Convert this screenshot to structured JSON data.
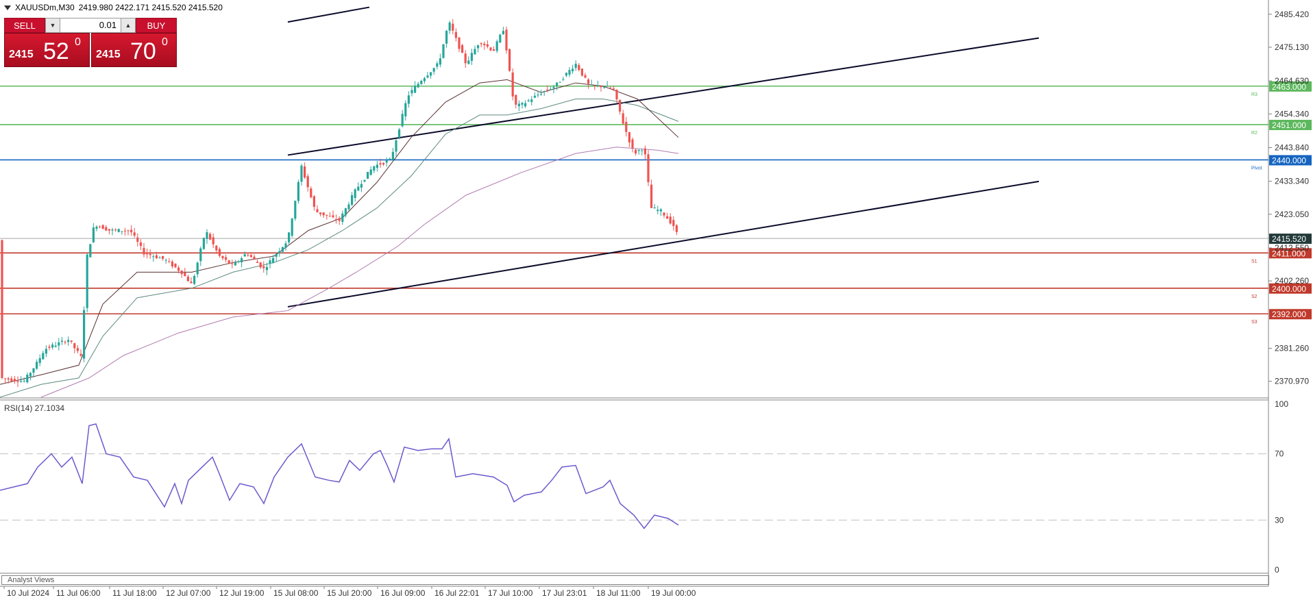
{
  "header": {
    "symbol": "XAUUSDm,M30",
    "ohlc": "2419.980 2422.171 2415.520 2415.520"
  },
  "trade_panel": {
    "sell_label": "SELL",
    "buy_label": "BUY",
    "volume": "0.01",
    "bid_small": "2415",
    "bid_big": "52",
    "bid_sup": "0",
    "ask_small": "2415",
    "ask_big": "70",
    "ask_sup": "0"
  },
  "colors": {
    "bull": "#26a69a",
    "bear": "#ef5350",
    "resistance": "#5cb85c",
    "support": "#c0392b",
    "pivot": "#1565c0",
    "channel": "#0a0a2a",
    "rsi": "#6a5acd"
  },
  "price_axis": {
    "ticks": [
      "2485.420",
      "2475.130",
      "2464.630",
      "2454.340",
      "2443.840",
      "2433.340",
      "2423.050",
      "2412.550",
      "2402.260",
      "2381.260",
      "2370.970"
    ],
    "current_price": "2415.520"
  },
  "levels": [
    {
      "price": "2463.000",
      "code": "R3",
      "kind": "resistance"
    },
    {
      "price": "2451.000",
      "code": "R2",
      "kind": "resistance"
    },
    {
      "price": "2440.000",
      "code": "Pivot",
      "kind": "pivot"
    },
    {
      "price": "2411.000",
      "code": "S1",
      "kind": "support"
    },
    {
      "price": "2400.000",
      "code": "S2",
      "kind": "support"
    },
    {
      "price": "2392.000",
      "code": "S3",
      "kind": "support"
    }
  ],
  "time_axis": [
    "10 Jul 2024",
    "11 Jul 06:00",
    "11 Jul 18:00",
    "12 Jul 07:00",
    "12 Jul 19:00",
    "15 Jul 08:00",
    "15 Jul 20:00",
    "16 Jul 09:00",
    "16 Jul 22:01",
    "17 Jul 10:00",
    "17 Jul 23:01",
    "18 Jul 11:00",
    "19 Jul 00:00"
  ],
  "rsi": {
    "label": "RSI(14) 27.1034",
    "ticks": [
      "100",
      "70",
      "30",
      "0"
    ],
    "levels": [
      70,
      30
    ],
    "range": [
      0,
      100
    ]
  },
  "footer": {
    "analyst_label": "Analyst Views"
  },
  "chart_data": {
    "type": "line",
    "price_range": [
      2366,
      2489
    ],
    "time_range": [
      "10 Jul 2024",
      "19 Jul 03:00"
    ],
    "main_path": [
      [
        2372,
        0
      ],
      [
        2371,
        35
      ],
      [
        2377,
        55
      ],
      [
        2381,
        65
      ],
      [
        2384,
        100
      ],
      [
        2378,
        120
      ],
      [
        2408,
        125
      ],
      [
        2420,
        138
      ],
      [
        2418,
        160
      ],
      [
        2418,
        190
      ],
      [
        2411,
        210
      ],
      [
        2409,
        240
      ],
      [
        2405,
        265
      ],
      [
        2401,
        280
      ],
      [
        2418,
        300
      ],
      [
        2410,
        320
      ],
      [
        2407,
        340
      ],
      [
        2411,
        360
      ],
      [
        2406,
        385
      ],
      [
        2410,
        400
      ],
      [
        2415,
        420
      ],
      [
        2438,
        440
      ],
      [
        2424,
        460
      ],
      [
        2421,
        495
      ],
      [
        2431,
        520
      ],
      [
        2438,
        545
      ],
      [
        2440,
        570
      ],
      [
        2460,
        595
      ],
      [
        2465,
        615
      ],
      [
        2470,
        640
      ],
      [
        2483,
        655
      ],
      [
        2470,
        680
      ],
      [
        2477,
        700
      ],
      [
        2474,
        720
      ],
      [
        2481,
        735
      ],
      [
        2457,
        750
      ],
      [
        2457,
        760
      ],
      [
        2461,
        790
      ],
      [
        2463,
        810
      ],
      [
        2470,
        840
      ],
      [
        2463,
        860
      ],
      [
        2463,
        880
      ],
      [
        2462,
        895
      ],
      [
        2451,
        910
      ],
      [
        2442,
        925
      ],
      [
        2444,
        940
      ],
      [
        2425,
        950
      ],
      [
        2424,
        965
      ],
      [
        2419,
        985
      ],
      [
        2415,
        990
      ]
    ],
    "ma_fast": [
      [
        2370,
        0
      ],
      [
        2373,
        60
      ],
      [
        2376,
        115
      ],
      [
        2395,
        150
      ],
      [
        2405,
        200
      ],
      [
        2405,
        280
      ],
      [
        2408,
        340
      ],
      [
        2410,
        400
      ],
      [
        2418,
        450
      ],
      [
        2422,
        500
      ],
      [
        2433,
        550
      ],
      [
        2447,
        600
      ],
      [
        2458,
        650
      ],
      [
        2464,
        700
      ],
      [
        2465,
        740
      ],
      [
        2461,
        790
      ],
      [
        2464,
        840
      ],
      [
        2463,
        880
      ],
      [
        2459,
        930
      ],
      [
        2447,
        990
      ]
    ],
    "ma_slow": [
      [
        2366,
        0
      ],
      [
        2370,
        60
      ],
      [
        2372,
        115
      ],
      [
        2385,
        150
      ],
      [
        2397,
        200
      ],
      [
        2400,
        280
      ],
      [
        2405,
        340
      ],
      [
        2408,
        400
      ],
      [
        2412,
        450
      ],
      [
        2418,
        500
      ],
      [
        2425,
        550
      ],
      [
        2435,
        600
      ],
      [
        2448,
        650
      ],
      [
        2454,
        700
      ],
      [
        2454,
        740
      ],
      [
        2456,
        790
      ],
      [
        2459,
        840
      ],
      [
        2459,
        880
      ],
      [
        2457,
        930
      ],
      [
        2452,
        990
      ]
    ],
    "ma_long": [
      [
        2366,
        60
      ],
      [
        2372,
        130
      ],
      [
        2379,
        180
      ],
      [
        2386,
        260
      ],
      [
        2391,
        340
      ],
      [
        2393,
        420
      ],
      [
        2400,
        480
      ],
      [
        2405,
        520
      ],
      [
        2413,
        580
      ],
      [
        2420,
        620
      ],
      [
        2429,
        680
      ],
      [
        2436,
        760
      ],
      [
        2442,
        840
      ],
      [
        2444,
        900
      ],
      [
        2443,
        960
      ],
      [
        2442,
        990
      ]
    ],
    "channel_lines": [
      {
        "name": "upper",
        "points": [
          [
            2441.5,
            420
          ],
          [
            2478,
            1516
          ]
        ]
      },
      {
        "name": "lower",
        "points": [
          [
            2394.2,
            420
          ],
          [
            2433.3,
            1516
          ]
        ]
      },
      {
        "name": "top-segment",
        "points": [
          [
            2483,
            420
          ],
          [
            2487.6,
            539
          ]
        ]
      }
    ],
    "rsi_path": [
      [
        48,
        0
      ],
      [
        50,
        20
      ],
      [
        52,
        40
      ],
      [
        62,
        55
      ],
      [
        70,
        75
      ],
      [
        62,
        90
      ],
      [
        68,
        105
      ],
      [
        52,
        120
      ],
      [
        87,
        130
      ],
      [
        88,
        140
      ],
      [
        70,
        155
      ],
      [
        68,
        175
      ],
      [
        56,
        195
      ],
      [
        54,
        215
      ],
      [
        38,
        240
      ],
      [
        52,
        255
      ],
      [
        40,
        265
      ],
      [
        54,
        275
      ],
      [
        62,
        295
      ],
      [
        68,
        310
      ],
      [
        58,
        320
      ],
      [
        42,
        335
      ],
      [
        52,
        350
      ],
      [
        50,
        370
      ],
      [
        40,
        385
      ],
      [
        56,
        400
      ],
      [
        68,
        420
      ],
      [
        76,
        440
      ],
      [
        56,
        460
      ],
      [
        54,
        480
      ],
      [
        53,
        495
      ],
      [
        66,
        510
      ],
      [
        60,
        525
      ],
      [
        70,
        545
      ],
      [
        72,
        555
      ],
      [
        63,
        565
      ],
      [
        53,
        575
      ],
      [
        74,
        590
      ],
      [
        72,
        610
      ],
      [
        73,
        630
      ],
      [
        73,
        645
      ],
      [
        79,
        655
      ],
      [
        56,
        665
      ],
      [
        58,
        690
      ],
      [
        56,
        720
      ],
      [
        51,
        740
      ],
      [
        41,
        750
      ],
      [
        45,
        765
      ],
      [
        47,
        790
      ],
      [
        54,
        805
      ],
      [
        62,
        820
      ],
      [
        63,
        840
      ],
      [
        46,
        855
      ],
      [
        50,
        880
      ],
      [
        54,
        890
      ],
      [
        40,
        905
      ],
      [
        33,
        925
      ],
      [
        25,
        940
      ],
      [
        33,
        955
      ],
      [
        31,
        975
      ],
      [
        27,
        990
      ]
    ]
  }
}
